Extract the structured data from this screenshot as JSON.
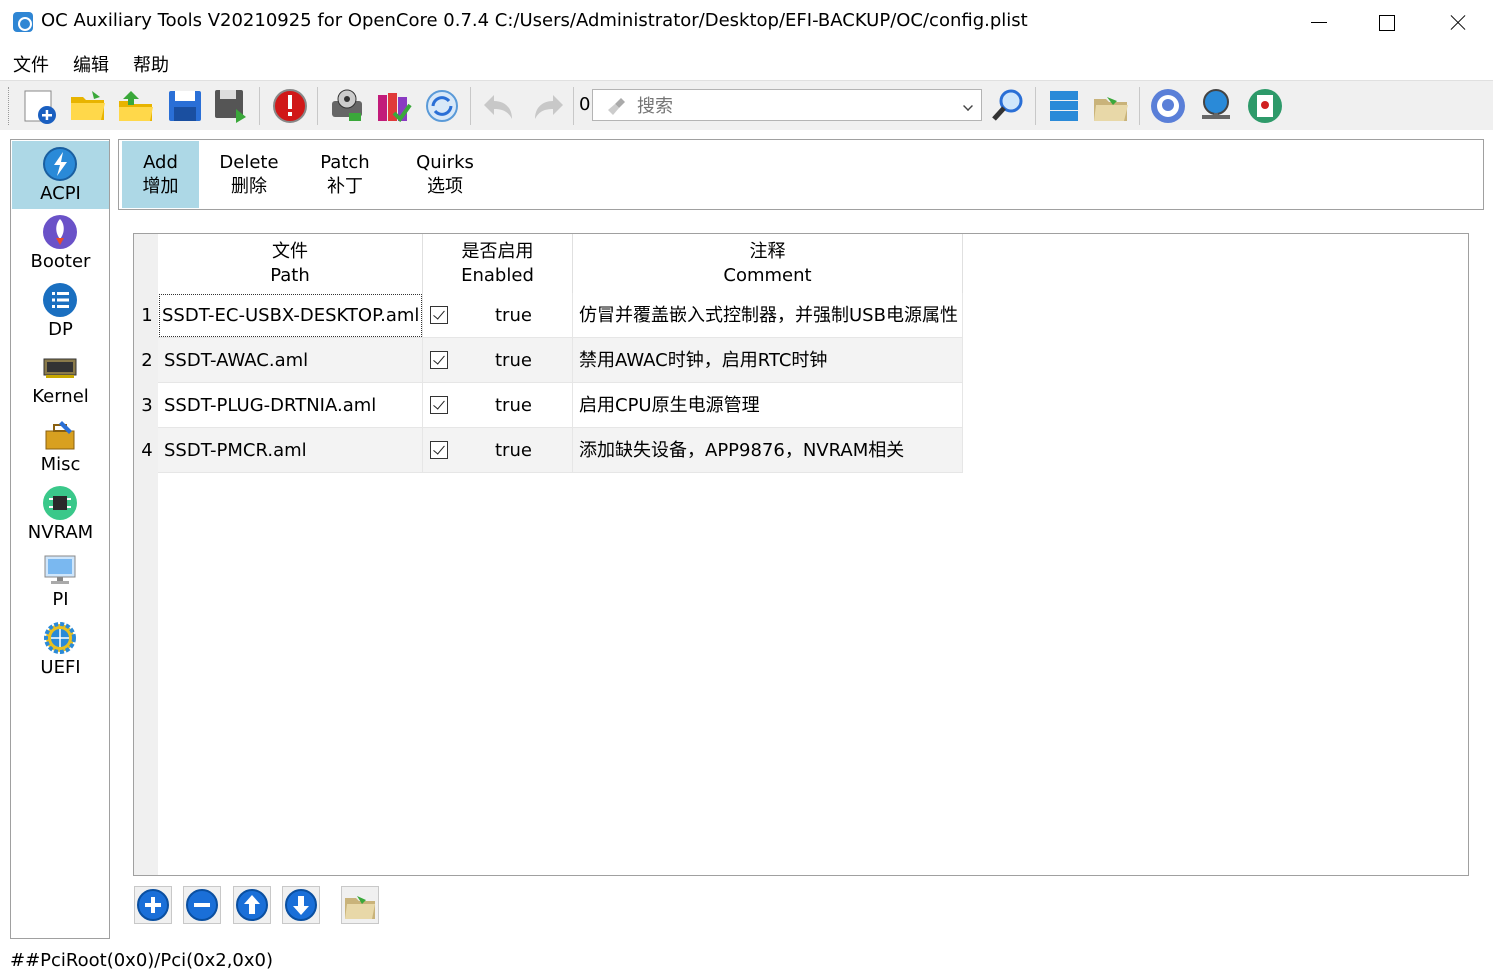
{
  "window": {
    "title": "OC Auxiliary Tools   V20210925 for OpenCore 0.7.4   C:/Users/Administrator/Desktop/EFI-BACKUP/OC/config.plist"
  },
  "menu": {
    "file": "文件",
    "edit": "编辑",
    "help": "帮助"
  },
  "toolbar": {
    "search_count": "0",
    "search_placeholder": "搜索"
  },
  "sidebar": {
    "items": [
      {
        "label": "ACPI",
        "icon": "lightning-icon",
        "active": true
      },
      {
        "label": "Booter",
        "icon": "rocket-icon"
      },
      {
        "label": "DP",
        "icon": "list-icon"
      },
      {
        "label": "Kernel",
        "icon": "chip-board-icon"
      },
      {
        "label": "Misc",
        "icon": "toolbox-icon"
      },
      {
        "label": "NVRAM",
        "icon": "memory-chip-icon"
      },
      {
        "label": "PI",
        "icon": "monitor-icon"
      },
      {
        "label": "UEFI",
        "icon": "globe-gear-icon"
      }
    ]
  },
  "tabs": [
    {
      "en": "Add",
      "zh": "增加",
      "active": true
    },
    {
      "en": "Delete",
      "zh": "删除"
    },
    {
      "en": "Patch",
      "zh": "补丁"
    },
    {
      "en": "Quirks",
      "zh": "选项"
    }
  ],
  "table": {
    "headers": [
      {
        "zh": "文件",
        "en": "Path"
      },
      {
        "zh": "是否启用",
        "en": "Enabled"
      },
      {
        "zh": "注释",
        "en": "Comment"
      }
    ],
    "rows": [
      {
        "num": "1",
        "path": "SSDT-EC-USBX-DESKTOP.aml",
        "enabled": "true",
        "comment": "仿冒并覆盖嵌入式控制器，并强制USB电源属性"
      },
      {
        "num": "2",
        "path": "SSDT-AWAC.aml",
        "enabled": "true",
        "comment": "禁用AWAC时钟，启用RTC时钟"
      },
      {
        "num": "3",
        "path": "SSDT-PLUG-DRTNIA.aml",
        "enabled": "true",
        "comment": "启用CPU原生电源管理"
      },
      {
        "num": "4",
        "path": "SSDT-PMCR.aml",
        "enabled": "true",
        "comment": "添加缺失设备，APP9876，NVRAM相关"
      }
    ]
  },
  "status": {
    "text": "##PciRoot(0x0)/Pci(0x2,0x0)"
  },
  "colors": {
    "active_bg": "#add8e6",
    "toolbar_bg": "#f0f0f0",
    "accent_blue": "#2a6fd6"
  }
}
